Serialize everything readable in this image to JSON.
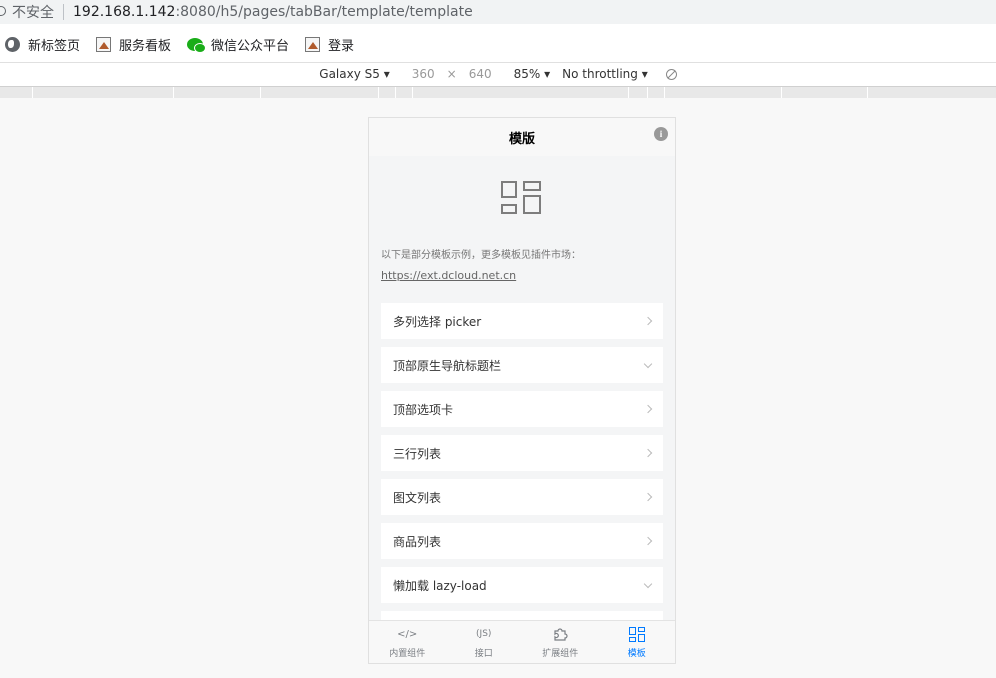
{
  "browser": {
    "insecure_label": "不安全",
    "url_host": "192.168.1.142",
    "url_path": ":8080/h5/pages/tabBar/template/template"
  },
  "bookmarks": [
    {
      "label": "新标签页",
      "icon": "globe-icon"
    },
    {
      "label": "服务看板",
      "icon": "image-icon"
    },
    {
      "label": "微信公众平台",
      "icon": "wechat-icon"
    },
    {
      "label": "登录",
      "icon": "image-icon"
    }
  ],
  "devtools": {
    "device": "Galaxy S5 ▾",
    "width": "360",
    "times": "×",
    "height": "640",
    "zoom": "85% ▾",
    "throttling": "No throttling ▾"
  },
  "page": {
    "title": "模版",
    "info_icon": "i",
    "intro_text": "以下是部分模板示例，更多模板见插件市场：",
    "intro_link": "https://ext.dcloud.net.cn",
    "items": [
      {
        "label": "多列选择 picker",
        "chevron": "right"
      },
      {
        "label": "顶部原生导航标题栏",
        "chevron": "down"
      },
      {
        "label": "顶部选项卡",
        "chevron": "right"
      },
      {
        "label": "三行列表",
        "chevron": "right"
      },
      {
        "label": "图文列表",
        "chevron": "right"
      },
      {
        "label": "商品列表",
        "chevron": "right"
      },
      {
        "label": "懒加载 lazy-load",
        "chevron": "down"
      }
    ]
  },
  "tabbar": [
    {
      "label": "内置组件",
      "icon_text": "</>",
      "active": false
    },
    {
      "label": "接口",
      "icon_text": "(JS)",
      "active": false
    },
    {
      "label": "扩展组件",
      "icon_text": "",
      "active": false
    },
    {
      "label": "模板",
      "icon_text": "",
      "active": true
    }
  ],
  "colors": {
    "active": "#007aff",
    "inactive": "#7a7e83"
  }
}
